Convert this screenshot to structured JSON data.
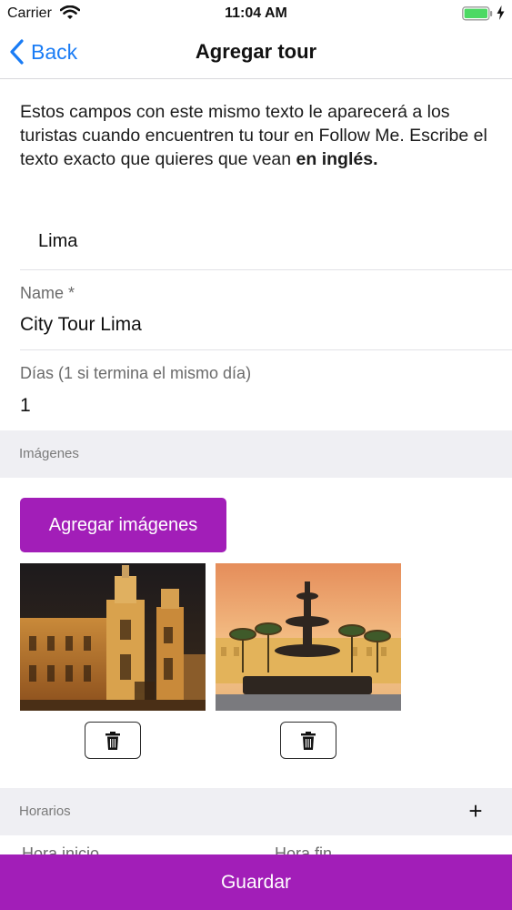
{
  "status_bar": {
    "carrier": "Carrier",
    "time": "11:04 AM",
    "battery_color": "#4cd964"
  },
  "nav": {
    "back_label": "Back",
    "title": "Agregar tour"
  },
  "intro": {
    "text": "Estos campos con este mismo texto le aparecerá a los turistas cuando encuentren tu tour en Follow Me. Escribe el texto exacto que quieres que vean ",
    "bold": "en inglés."
  },
  "city": {
    "value": "Lima"
  },
  "name_field": {
    "label": "Name *",
    "value": "City Tour Lima"
  },
  "days_field": {
    "label": "Días (1 si termina el mismo día)",
    "value": "1"
  },
  "images_section": {
    "label": "Imágenes",
    "add_button": "Agregar imágenes",
    "images": [
      {
        "icon": "cathedral-photo"
      },
      {
        "icon": "fountain-photo"
      }
    ]
  },
  "schedule_section": {
    "label": "Horarios",
    "add_icon": "+",
    "start_label": "Hora inicio",
    "end_label": "Hora fin"
  },
  "save_button": "Guardar",
  "colors": {
    "accent": "#a21eb8",
    "link": "#1a7cf5"
  }
}
